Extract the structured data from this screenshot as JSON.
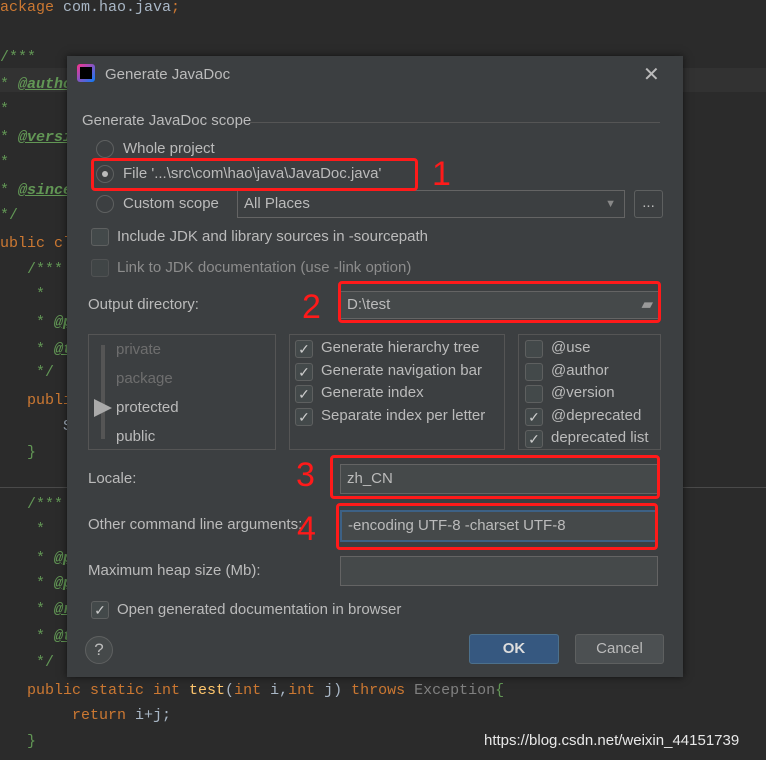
{
  "editor": {
    "lines": [
      {
        "segs": [
          {
            "t": "ackage",
            "c": "kw"
          },
          {
            "t": " com.hao.java",
            "c": ""
          },
          {
            "t": ";",
            "c": "kw"
          }
        ]
      },
      {
        "segs": [
          {
            "t": "/***",
            "c": "cm"
          }
        ]
      },
      {
        "segs": [
          {
            "t": "* ",
            "c": "cm"
          },
          {
            "t": "@autho",
            "c": "tag"
          }
        ]
      },
      {
        "segs": [
          {
            "t": "*",
            "c": "cm"
          }
        ]
      },
      {
        "segs": [
          {
            "t": "* ",
            "c": "cm"
          },
          {
            "t": "@versi",
            "c": "tag"
          }
        ]
      },
      {
        "segs": [
          {
            "t": "*",
            "c": "cm"
          }
        ]
      },
      {
        "segs": [
          {
            "t": "* ",
            "c": "cm"
          },
          {
            "t": "@since",
            "c": "tag"
          }
        ]
      },
      {
        "segs": [
          {
            "t": "*/",
            "c": "cm"
          }
        ]
      },
      {
        "segs": [
          {
            "t": "ublic cl",
            "c": "kw"
          }
        ]
      },
      {
        "segs": [
          {
            "t": "   /***",
            "c": "cm"
          }
        ]
      },
      {
        "segs": [
          {
            "t": "    *",
            "c": "cm"
          }
        ]
      },
      {
        "segs": [
          {
            "t": "    * ",
            "c": "cm"
          },
          {
            "t": "@p",
            "c": "tag"
          }
        ]
      },
      {
        "segs": [
          {
            "t": "    * ",
            "c": "cm"
          },
          {
            "t": "@t",
            "c": "tag"
          }
        ]
      },
      {
        "segs": [
          {
            "t": "    */",
            "c": "cm"
          }
        ]
      },
      {
        "segs": [
          {
            "t": "   publi",
            "c": "kw"
          }
        ]
      },
      {
        "segs": [
          {
            "t": "       S",
            "c": ""
          }
        ]
      },
      {
        "segs": [
          {
            "t": "   }",
            "c": "cm"
          }
        ]
      },
      {
        "segs": [
          {
            "t": "   /***",
            "c": "cm"
          }
        ]
      },
      {
        "segs": [
          {
            "t": "    *",
            "c": "cm"
          }
        ]
      },
      {
        "segs": [
          {
            "t": "    * ",
            "c": "cm"
          },
          {
            "t": "@p",
            "c": "tag"
          }
        ]
      },
      {
        "segs": [
          {
            "t": "    * ",
            "c": "cm"
          },
          {
            "t": "@p",
            "c": "tag"
          }
        ]
      },
      {
        "segs": [
          {
            "t": "    * ",
            "c": "cm"
          },
          {
            "t": "@r",
            "c": "tag"
          }
        ]
      },
      {
        "segs": [
          {
            "t": "    * ",
            "c": "cm"
          },
          {
            "t": "@t",
            "c": "tag"
          }
        ]
      },
      {
        "segs": [
          {
            "t": "    */",
            "c": "cm"
          }
        ]
      },
      {
        "segs": [
          {
            "t": "   public static int ",
            "c": "kw"
          },
          {
            "t": "test",
            "c": "fn"
          },
          {
            "t": "(",
            "c": ""
          },
          {
            "t": "int ",
            "c": "kw"
          },
          {
            "t": "i,",
            "c": ""
          },
          {
            "t": "int ",
            "c": "kw"
          },
          {
            "t": "j) ",
            "c": ""
          },
          {
            "t": "throws ",
            "c": "kw"
          },
          {
            "t": "Exception",
            "c": "ex"
          },
          {
            "t": "{",
            "c": "cm"
          }
        ]
      },
      {
        "segs": [
          {
            "t": "        return ",
            "c": "kw"
          },
          {
            "t": "i+j;",
            "c": ""
          }
        ]
      },
      {
        "segs": [
          {
            "t": "   }",
            "c": "cm"
          }
        ]
      }
    ]
  },
  "dialog": {
    "title": "Generate JavaDoc",
    "scope_label": "Generate JavaDoc scope",
    "scope_options": [
      {
        "label": "Whole project",
        "selected": false
      },
      {
        "label": "File '...\\src\\com\\hao\\java\\JavaDoc.java'",
        "selected": true
      },
      {
        "label": "Custom scope",
        "selected": false
      }
    ],
    "custom_scope_value": "All Places",
    "browse_label": "...",
    "include_jdk": {
      "label": "Include JDK and library sources in -sourcepath",
      "checked": false
    },
    "link_jdk": {
      "label": "Link to JDK documentation (use -link option)",
      "checked": false,
      "disabled": true
    },
    "output_dir_label": "Output directory:",
    "output_dir_value": "D:\\test",
    "visibility_levels": [
      "private",
      "package",
      "protected",
      "public"
    ],
    "visibility_selected": "protected",
    "generate_options": [
      {
        "label": "Generate hierarchy tree",
        "checked": true
      },
      {
        "label": "Generate navigation bar",
        "checked": true
      },
      {
        "label": "Generate index",
        "checked": true
      },
      {
        "label": "Separate index per letter",
        "checked": true
      }
    ],
    "tag_options": [
      {
        "label": "@use",
        "checked": false
      },
      {
        "label": "@author",
        "checked": false
      },
      {
        "label": "@version",
        "checked": false
      },
      {
        "label": "@deprecated",
        "checked": true
      },
      {
        "label": "deprecated list",
        "checked": true
      }
    ],
    "locale_label": "Locale:",
    "locale_value": "zh_CN",
    "args_label": "Other command line arguments:",
    "args_value": "-encoding UTF-8 -charset UTF-8",
    "heap_label": "Maximum heap size (Mb):",
    "heap_value": "",
    "open_browser": {
      "label": "Open generated documentation in browser",
      "checked": true
    },
    "help_label": "?",
    "ok_label": "OK",
    "cancel_label": "Cancel"
  },
  "annotations": [
    "1",
    "2",
    "3",
    "4"
  ],
  "watermark": "https://blog.csdn.net/weixin_44151739",
  "colors": {
    "accent": "#365880",
    "annotation": "#ff1a1a",
    "dialog_bg": "#3c3f41",
    "editor_bg": "#2b2b2b"
  }
}
